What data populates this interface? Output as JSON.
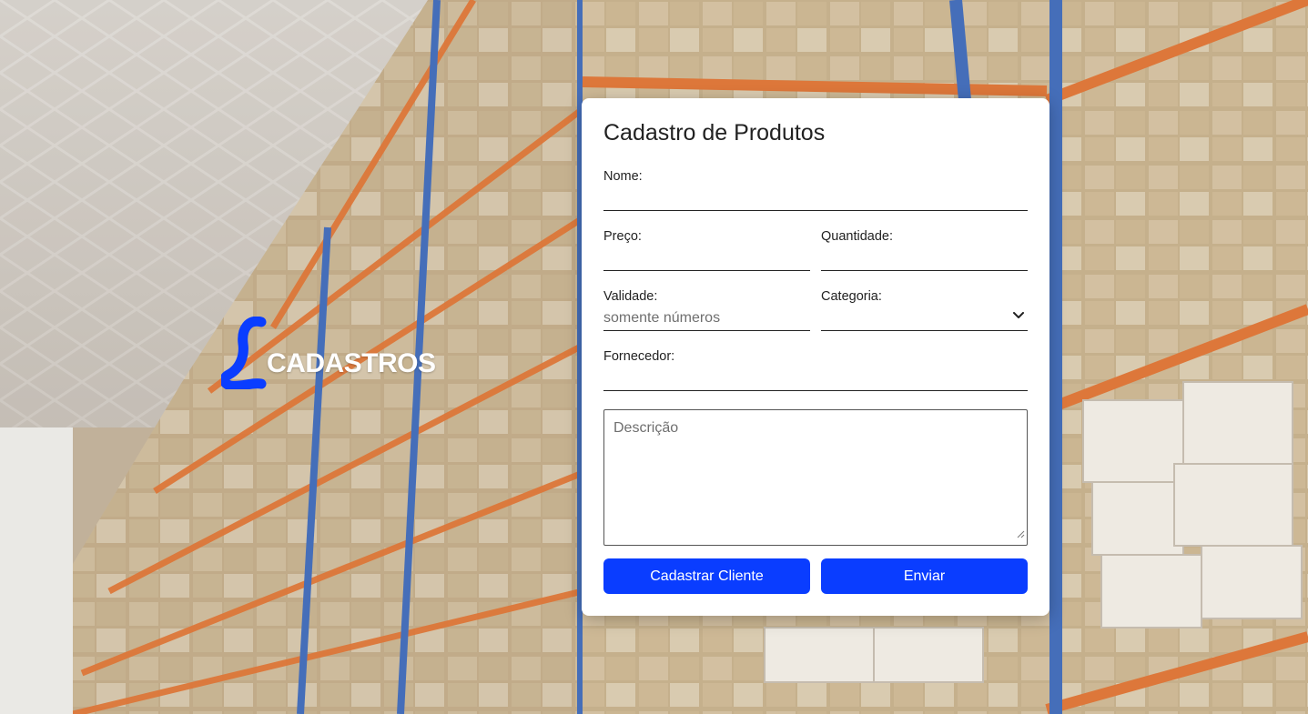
{
  "brand": {
    "logo_letter": "L",
    "name": "CADASTROS",
    "logo_color": "#0a3dff"
  },
  "form": {
    "title": "Cadastro de Produtos",
    "fields": {
      "nome": {
        "label": "Nome:",
        "value": ""
      },
      "preco": {
        "label": "Preço:",
        "value": ""
      },
      "quantidade": {
        "label": "Quantidade:",
        "value": ""
      },
      "validade": {
        "label": "Validade:",
        "value": "",
        "placeholder": "somente números"
      },
      "categoria": {
        "label": "Categoria:",
        "selected": ""
      },
      "fornecedor": {
        "label": "Fornecedor:",
        "value": ""
      },
      "descricao": {
        "placeholder": "Descrição",
        "value": ""
      }
    },
    "buttons": {
      "cadastrar_cliente": "Cadastrar Cliente",
      "enviar": "Enviar"
    }
  },
  "colors": {
    "accent": "#0a3dff",
    "card_background": "#ffffff",
    "text": "#222222"
  },
  "icons": {
    "select_arrow": "chevron-down-icon",
    "textarea_grip": "resize-grip-icon"
  }
}
